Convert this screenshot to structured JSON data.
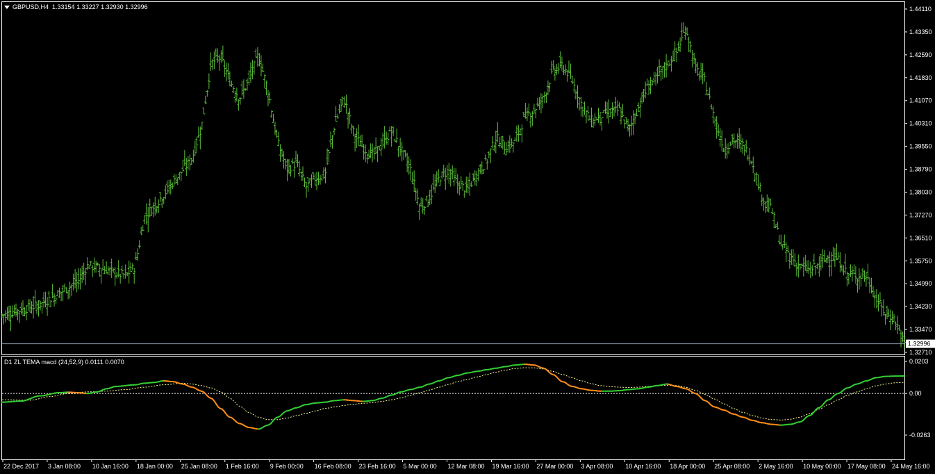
{
  "window": {
    "symbol_label": "GBPUSD,H4",
    "ohlc": "1.33154 1.33227 1.32930 1.32996",
    "indicator_label": "D1 ZL TEMA macd (24,52,9) 0.0111 0.0070"
  },
  "colors": {
    "background": "#000000",
    "bars": "#5cbf3a",
    "macd_up": "#33cc33",
    "macd_down": "#ff8c1a",
    "signal": "#ffff99",
    "text": "#ffffff",
    "grid_line": "#8c9fb2"
  },
  "chart_data": [
    {
      "type": "ohlc",
      "series_name": "GBPUSD,H4",
      "ylim": [
        1.3271,
        1.4411
      ],
      "y_ticks": [
        "1.44110",
        "1.43350",
        "1.42590",
        "1.41830",
        "1.41070",
        "1.40310",
        "1.39550",
        "1.38790",
        "1.38030",
        "1.37270",
        "1.36510",
        "1.35750",
        "1.34990",
        "1.34230",
        "1.33470",
        "1.32710"
      ],
      "current_price": "1.32996",
      "x_ticks": [
        "22 Dec 2017",
        "3 Jan 08:00",
        "10 Jan 16:00",
        "18 Jan 00:00",
        "25 Jan 08:00",
        "1 Feb 16:00",
        "9 Feb 00:00",
        "16 Feb 08:00",
        "23 Feb 16:00",
        "5 Mar 00:00",
        "12 Mar 08:00",
        "19 Mar 16:00",
        "27 Mar 00:00",
        "3 Apr 08:00",
        "10 Apr 16:00",
        "18 Apr 00:00",
        "25 Apr 08:00",
        "2 May 16:00",
        "10 May 00:00",
        "17 May 08:00",
        "24 May 16:00"
      ],
      "close_path": [
        [
          0,
          1.3395
        ],
        [
          4,
          1.343
        ],
        [
          8,
          1.3505
        ],
        [
          9,
          1.356
        ],
        [
          11,
          1.3545
        ],
        [
          13,
          1.3525
        ],
        [
          14,
          1.3555
        ],
        [
          15,
          1.372
        ],
        [
          17,
          1.3795
        ],
        [
          18,
          1.3835
        ],
        [
          20,
          1.3915
        ],
        [
          21,
          1.402
        ],
        [
          22,
          1.423
        ],
        [
          23,
          1.4255
        ],
        [
          24,
          1.417
        ],
        [
          25,
          1.4115
        ],
        [
          26,
          1.4175
        ],
        [
          27,
          1.426
        ],
        [
          28,
          1.414
        ],
        [
          29,
          1.397
        ],
        [
          30,
          1.388
        ],
        [
          31,
          1.39
        ],
        [
          32,
          1.382
        ],
        [
          33,
          1.385
        ],
        [
          34,
          1.386
        ],
        [
          35,
          1.4025
        ],
        [
          36,
          1.4115
        ],
        [
          37,
          1.4
        ],
        [
          38,
          1.395
        ],
        [
          39,
          1.3925
        ],
        [
          40,
          1.396
        ],
        [
          41,
          1.4005
        ],
        [
          42,
          1.3945
        ],
        [
          43,
          1.388
        ],
        [
          44,
          1.375
        ],
        [
          45,
          1.3785
        ],
        [
          46,
          1.385
        ],
        [
          47,
          1.3875
        ],
        [
          48,
          1.383
        ],
        [
          49,
          1.381
        ],
        [
          50,
          1.3865
        ],
        [
          51,
          1.3905
        ],
        [
          52,
          1.3985
        ],
        [
          53,
          1.395
        ],
        [
          54,
          1.397
        ],
        [
          55,
          1.405
        ],
        [
          56,
          1.4075
        ],
        [
          57,
          1.4115
        ],
        [
          58,
          1.4205
        ],
        [
          59,
          1.4225
        ],
        [
          60,
          1.4175
        ],
        [
          61,
          1.4095
        ],
        [
          62,
          1.404
        ],
        [
          63,
          1.4055
        ],
        [
          64,
          1.407
        ],
        [
          65,
          1.4075
        ],
        [
          66,
          1.401
        ],
        [
          67,
          1.4085
        ],
        [
          68,
          1.4155
        ],
        [
          69,
          1.4185
        ],
        [
          70,
          1.4225
        ],
        [
          71,
          1.4265
        ],
        [
          72,
          1.435
        ],
        [
          73,
          1.4215
        ],
        [
          74,
          1.417
        ],
        [
          75,
          1.405
        ],
        [
          76,
          1.395
        ],
        [
          77,
          1.3975
        ],
        [
          78,
          1.396
        ],
        [
          79,
          1.3905
        ],
        [
          80,
          1.379
        ],
        [
          81,
          1.3745
        ],
        [
          82,
          1.363
        ],
        [
          83,
          1.359
        ],
        [
          84,
          1.3555
        ],
        [
          85,
          1.3545
        ],
        [
          86,
          1.356
        ],
        [
          87,
          1.359
        ],
        [
          88,
          1.358
        ],
        [
          89,
          1.353
        ],
        [
          90,
          1.3525
        ],
        [
          91,
          1.3525
        ],
        [
          92,
          1.345
        ],
        [
          93,
          1.34
        ],
        [
          94,
          1.338
        ],
        [
          95,
          1.3299
        ]
      ]
    },
    {
      "type": "line",
      "title": "D1 ZL TEMA macd (24,52,9)",
      "ylim": [
        -0.0263,
        0.0203
      ],
      "y_ticks": [
        "0.0203",
        "0.00",
        "-0.0263"
      ],
      "macd": {
        "values": [
          [
            0,
            -0.0055
          ],
          [
            2,
            -0.0048
          ],
          [
            4,
            -0.0015
          ],
          [
            6,
            0.0005
          ],
          [
            7,
            0.0008
          ],
          [
            8,
            0.0005
          ],
          [
            9,
            0.0
          ],
          [
            10,
            0.001
          ],
          [
            11,
            0.003
          ],
          [
            12,
            0.0045
          ],
          [
            14,
            0.0055
          ],
          [
            15,
            0.0065
          ],
          [
            16,
            0.007
          ],
          [
            17,
            0.008
          ],
          [
            18,
            0.0075
          ],
          [
            19,
            0.006
          ],
          [
            20,
            0.004
          ],
          [
            21,
            0.0015
          ],
          [
            22,
            -0.003
          ],
          [
            23,
            -0.0095
          ],
          [
            24,
            -0.015
          ],
          [
            25,
            -0.019
          ],
          [
            26,
            -0.0215
          ],
          [
            27,
            -0.0225
          ],
          [
            28,
            -0.02
          ],
          [
            29,
            -0.015
          ],
          [
            30,
            -0.011
          ],
          [
            31,
            -0.009
          ],
          [
            32,
            -0.007
          ],
          [
            33,
            -0.006
          ],
          [
            34,
            -0.0055
          ],
          [
            35,
            -0.0045
          ],
          [
            36,
            -0.004
          ],
          [
            37,
            -0.0045
          ],
          [
            38,
            -0.005
          ],
          [
            39,
            -0.0045
          ],
          [
            40,
            -0.003
          ],
          [
            41,
            -0.001
          ],
          [
            42,
            0.001
          ],
          [
            43,
            0.0025
          ],
          [
            44,
            0.004
          ],
          [
            45,
            0.006
          ],
          [
            46,
            0.008
          ],
          [
            47,
            0.01
          ],
          [
            48,
            0.0115
          ],
          [
            49,
            0.013
          ],
          [
            50,
            0.014
          ],
          [
            51,
            0.015
          ],
          [
            52,
            0.016
          ],
          [
            53,
            0.017
          ],
          [
            54,
            0.018
          ],
          [
            55,
            0.0185
          ],
          [
            56,
            0.018
          ],
          [
            57,
            0.016
          ],
          [
            58,
            0.012
          ],
          [
            59,
            0.0075
          ],
          [
            60,
            0.0045
          ],
          [
            61,
            0.003
          ],
          [
            62,
            0.002
          ],
          [
            63,
            0.0015
          ],
          [
            64,
            0.0015
          ],
          [
            65,
            0.0018
          ],
          [
            66,
            0.0025
          ],
          [
            67,
            0.003
          ],
          [
            68,
            0.004
          ],
          [
            69,
            0.005
          ],
          [
            70,
            0.006
          ],
          [
            71,
            0.0045
          ],
          [
            72,
            0.003
          ],
          [
            73,
            0.0
          ],
          [
            74,
            -0.0045
          ],
          [
            75,
            -0.0085
          ],
          [
            76,
            -0.0105
          ],
          [
            77,
            -0.013
          ],
          [
            78,
            -0.015
          ],
          [
            79,
            -0.017
          ],
          [
            80,
            -0.0185
          ],
          [
            81,
            -0.0195
          ],
          [
            82,
            -0.02
          ],
          [
            83,
            -0.0195
          ],
          [
            84,
            -0.018
          ],
          [
            85,
            -0.014
          ],
          [
            86,
            -0.009
          ],
          [
            87,
            -0.004
          ],
          [
            88,
            0.0
          ],
          [
            89,
            0.0035
          ],
          [
            90,
            0.006
          ],
          [
            91,
            0.008
          ],
          [
            92,
            0.01
          ],
          [
            93,
            0.0108
          ],
          [
            94,
            0.011
          ],
          [
            95,
            0.0111
          ]
        ]
      },
      "signal": {
        "values": [
          [
            0,
            -0.004
          ],
          [
            3,
            -0.0042
          ],
          [
            5,
            -0.002
          ],
          [
            7,
            0.0
          ],
          [
            9,
            0.001
          ],
          [
            11,
            0.0015
          ],
          [
            13,
            0.0025
          ],
          [
            15,
            0.004
          ],
          [
            17,
            0.0055
          ],
          [
            19,
            0.0065
          ],
          [
            20,
            0.006
          ],
          [
            21,
            0.005
          ],
          [
            22,
            0.0035
          ],
          [
            23,
            0.001
          ],
          [
            24,
            -0.003
          ],
          [
            25,
            -0.008
          ],
          [
            26,
            -0.012
          ],
          [
            27,
            -0.015
          ],
          [
            28,
            -0.0165
          ],
          [
            29,
            -0.0165
          ],
          [
            30,
            -0.0155
          ],
          [
            31,
            -0.014
          ],
          [
            32,
            -0.0125
          ],
          [
            33,
            -0.011
          ],
          [
            34,
            -0.0095
          ],
          [
            35,
            -0.0085
          ],
          [
            36,
            -0.0075
          ],
          [
            37,
            -0.0068
          ],
          [
            38,
            -0.0062
          ],
          [
            39,
            -0.0058
          ],
          [
            40,
            -0.005
          ],
          [
            41,
            -0.004
          ],
          [
            42,
            -0.0028
          ],
          [
            43,
            -0.0012
          ],
          [
            44,
            0.0005
          ],
          [
            45,
            0.0022
          ],
          [
            46,
            0.004
          ],
          [
            47,
            0.0058
          ],
          [
            48,
            0.0075
          ],
          [
            49,
            0.009
          ],
          [
            50,
            0.0105
          ],
          [
            51,
            0.012
          ],
          [
            52,
            0.0135
          ],
          [
            53,
            0.0148
          ],
          [
            54,
            0.0158
          ],
          [
            55,
            0.0163
          ],
          [
            56,
            0.0162
          ],
          [
            57,
            0.0155
          ],
          [
            58,
            0.014
          ],
          [
            59,
            0.012
          ],
          [
            60,
            0.01
          ],
          [
            61,
            0.008
          ],
          [
            62,
            0.0062
          ],
          [
            63,
            0.005
          ],
          [
            64,
            0.0043
          ],
          [
            65,
            0.004
          ],
          [
            66,
            0.0038
          ],
          [
            67,
            0.004
          ],
          [
            68,
            0.0045
          ],
          [
            69,
            0.005
          ],
          [
            70,
            0.0052
          ],
          [
            71,
            0.005
          ],
          [
            72,
            0.004
          ],
          [
            73,
            0.002
          ],
          [
            74,
            -0.0005
          ],
          [
            75,
            -0.0035
          ],
          [
            76,
            -0.0065
          ],
          [
            77,
            -0.0095
          ],
          [
            78,
            -0.012
          ],
          [
            79,
            -0.014
          ],
          [
            80,
            -0.0155
          ],
          [
            81,
            -0.0165
          ],
          [
            82,
            -0.0168
          ],
          [
            83,
            -0.0163
          ],
          [
            84,
            -0.015
          ],
          [
            85,
            -0.0128
          ],
          [
            86,
            -0.01
          ],
          [
            87,
            -0.007
          ],
          [
            88,
            -0.004
          ],
          [
            89,
            -0.0012
          ],
          [
            90,
            0.001
          ],
          [
            91,
            0.003
          ],
          [
            92,
            0.0048
          ],
          [
            93,
            0.006
          ],
          [
            94,
            0.0068
          ],
          [
            95,
            0.007
          ]
        ]
      }
    }
  ]
}
